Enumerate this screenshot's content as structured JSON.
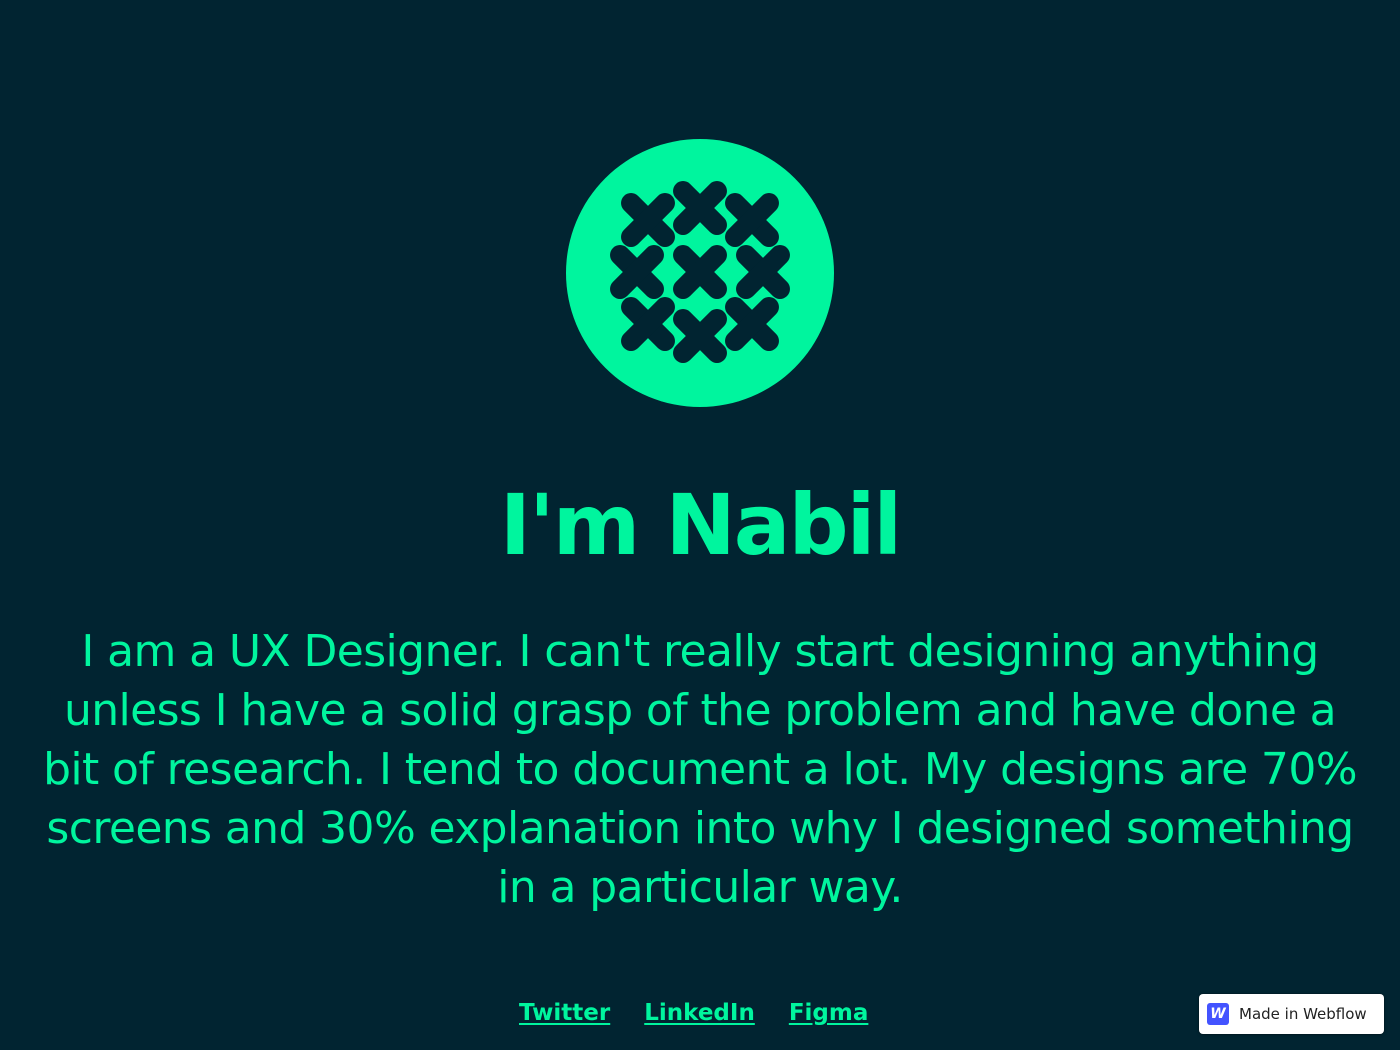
{
  "hero": {
    "logo_icon": "lattice-circle-logo-icon",
    "title": "I'm Nabil",
    "bio": "I am a UX Designer. I can't really start designing anything unless I have a solid grasp of the problem and have done a bit of research. I tend to document a lot. My designs are 70% screens and 30% explanation into why I designed something in a particular way."
  },
  "links": {
    "twitter": "Twitter",
    "linkedin": "LinkedIn",
    "figma": "Figma"
  },
  "badge": {
    "icon": "webflow-icon",
    "icon_glyph": "W",
    "label": "Made in Webflow"
  },
  "colors": {
    "background": "#012431",
    "accent": "#00f59e",
    "badge_brand": "#4353ff"
  }
}
